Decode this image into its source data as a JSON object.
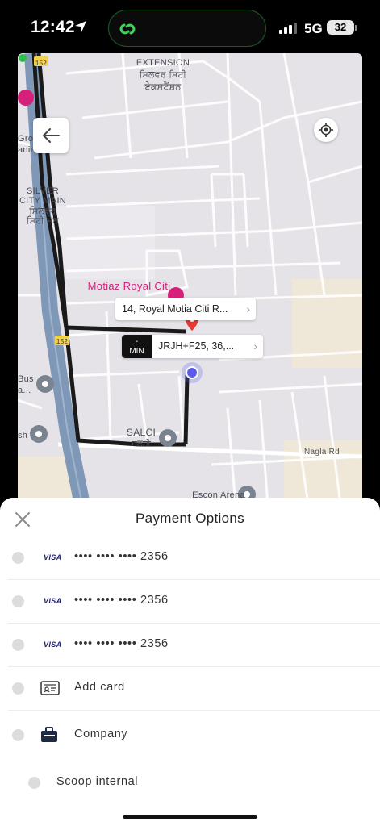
{
  "status_bar": {
    "time": "12:42",
    "network": "5G",
    "battery": "32"
  },
  "map": {
    "labels": {
      "area_top": "EXTENSION",
      "area_top_local": "ਸਿਲਵਰ ਸਿਟੀ",
      "area_top_local2": "ਏਕਸਟੈਂਸ਼ਨ",
      "silver_city": "SILVER",
      "silver_city2": "CITY MAIN",
      "silver_city_local": "ਸਿਲਵਰ",
      "silver_city_local2": "ਸਿਟੀ ਮੇਨ",
      "grou": "Grou",
      "anies": "anies",
      "motiaz": "Motiaz Royal Citi",
      "bus": "Bus",
      "bus2": "a...",
      "sh": "sh",
      "salci": "SALCI",
      "salci_local": "ਸਲਸੀ",
      "nagla_rd": "Nagla Rd",
      "escon_arena": "Escon Arena",
      "highway_152_top": "152",
      "highway_152_mid": "152"
    },
    "pickup_address": "14, Royal Motia Citi R...",
    "dropoff_address": "JRJH+F25, 36,...",
    "eta_value": "-",
    "eta_unit": "MIN"
  },
  "sheet": {
    "title": "Payment Options",
    "options": [
      {
        "type": "card",
        "brand": "VISA",
        "label": "•••• •••• •••• 2356"
      },
      {
        "type": "card",
        "brand": "VISA",
        "label": "•••• •••• •••• 2356"
      },
      {
        "type": "card",
        "brand": "VISA",
        "label": "•••• •••• •••• 2356"
      },
      {
        "type": "add",
        "icon": "card-id-icon",
        "label": "Add card"
      },
      {
        "type": "company",
        "icon": "briefcase-icon",
        "label": "Company"
      },
      {
        "type": "internal",
        "label": "Scoop internal"
      }
    ]
  },
  "colors": {
    "route": "#1a1a1a",
    "highway": "#7f98b8",
    "pin": "#e53935",
    "current_location": "#5b5bf0",
    "poi": "#d6207a"
  }
}
